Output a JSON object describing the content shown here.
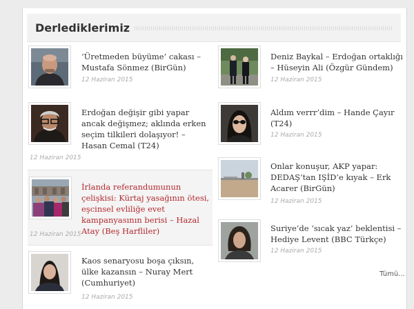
{
  "widget": {
    "title": "Derlediklerimiz",
    "more_label": "Tümü..."
  },
  "articles_left": [
    {
      "title": "‘Üretmeden büyüme’ cakası – Mustafa Sönmez (BirGün)",
      "date": "12 Haziran 2015",
      "thumb": "portrait-bald-man"
    },
    {
      "title": "Erdoğan değişir gibi yapar ancak değişmez; aklında erken seçim tilkileri dolaşıyor! – Hasan Cemal (T24)",
      "date": "12 Haziran 2015",
      "thumb": "portrait-man-glasses"
    },
    {
      "title": "İrlanda referandumunun çelişkisi: Kürtaj yasağının ötesi, eşcinsel evliliğe evet kampanyasının berisi – Hazal Atay (Beş Harfliler)",
      "date": "12 Haziran 2015",
      "thumb": "crowd-demonstration"
    },
    {
      "title": "Kaos senaryosu boşa çıksın, ülke kazansın – Nuray Mert (Cumhuriyet)",
      "date": "12 Haziran 2015",
      "thumb": "portrait-woman-dark-hair"
    }
  ],
  "articles_right": [
    {
      "title": "Deniz Baykal – Erdoğan ortaklığı – Hüseyin Ali (Özgür Gündem)",
      "date": "12 Haziran 2015",
      "thumb": "two-men-walking"
    },
    {
      "title": "Aldım verrr’dim – Hande Çayır (T24)",
      "date": "12 Haziran 2015",
      "thumb": "portrait-woman-sunglasses"
    },
    {
      "title": "Onlar konuşur, AKP yapar: DEDAŞ’tan IŞİD’e kıyak – Erk Acarer (BirGün)",
      "date": "12 Haziran 2015",
      "thumb": "border-landscape"
    },
    {
      "title": "Suriye’de ‘sıcak yaz’ beklentisi – Hediye Levent (BBC Türkçe)",
      "date": "12 Haziran 2015",
      "thumb": "portrait-woman-curly-hair"
    }
  ]
}
